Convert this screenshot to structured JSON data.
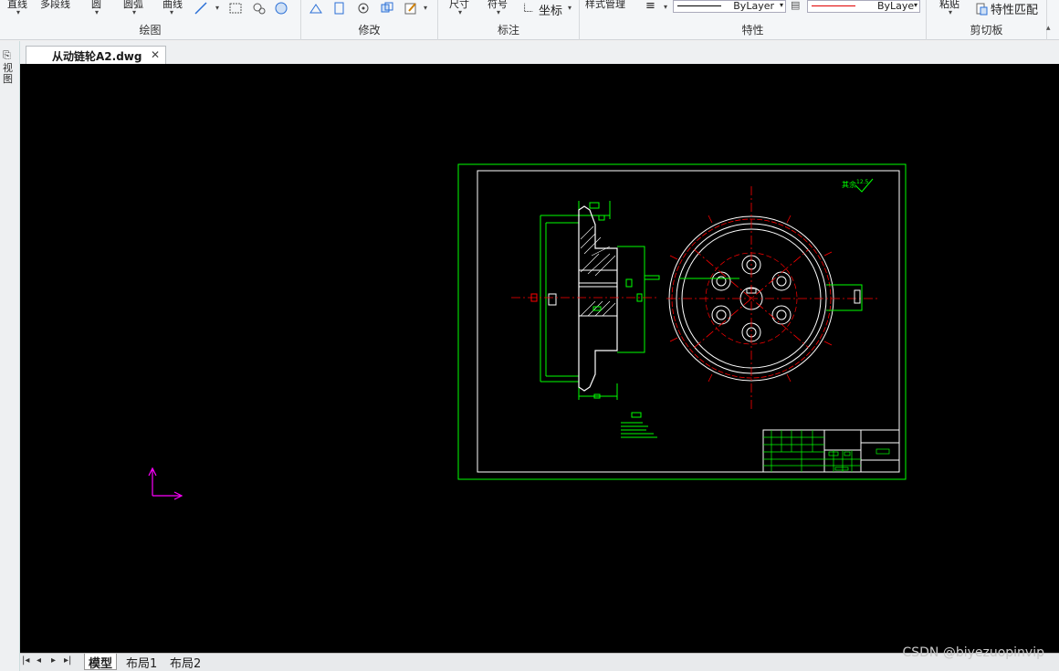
{
  "ribbon": {
    "draw_items": [
      "直线",
      "多段线",
      "圆",
      "圆弧",
      "曲线"
    ],
    "draw_label": "绘图",
    "modify_label": "修改",
    "annot_items": [
      "尺寸",
      "符号",
      "坐标"
    ],
    "annot_label": "标注",
    "style_manage": "样式管理",
    "linetype1": "ByLayer",
    "linetype2": "ByLayer",
    "props_label": "特性",
    "clip_items": [
      "粘贴",
      "特性匹配"
    ],
    "clip_label": "剪切板"
  },
  "tabs": {
    "doc_name": "从动链轮A2.dwg"
  },
  "left_strip": [
    "视",
    "图"
  ],
  "layouts": [
    "模型",
    "布局1",
    "布局2"
  ],
  "watermark": "CSDN @biyezuopinvip",
  "colors": {
    "frame": "#00ff00",
    "geometry": "#ffffff",
    "center": "#ff0000",
    "ucs": "#ff00ff"
  },
  "drawing": {
    "roughness_note": "其余",
    "roughness_value": "12.5"
  }
}
